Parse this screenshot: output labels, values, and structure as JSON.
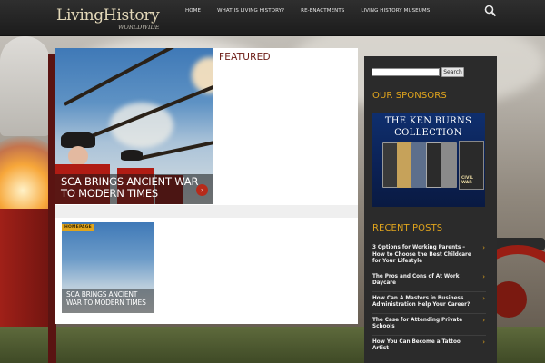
{
  "site": {
    "logo_main": "LivingHistory",
    "logo_sub": "WORLDWIDE"
  },
  "nav": {
    "items": [
      "HOME",
      "WHAT IS LIVING HISTORY?",
      "RE-ENACTMENTS",
      "LIVING HISTORY MUSEUMS"
    ]
  },
  "icons": {
    "search": "search-icon",
    "arrow": "chevron-right-icon"
  },
  "main": {
    "featured_heading": "FEATURED",
    "feature_caption": "SCA BRINGS ANCIENT WAR TO MODERN TIMES",
    "thumb_badge": "HOMEPAGE",
    "thumb_caption": "SCA BRINGS ANCIENT WAR TO MODERN TIMES"
  },
  "sidebar": {
    "search_button": "Search",
    "search_placeholder": "",
    "sponsors_heading": "OUR SPONSORS",
    "sponsor_title_1": "THE KEN BURNS",
    "sponsor_title_2": "COLLECTION",
    "sponsor_dvd_label": "CIVIL WAR",
    "recent_heading": "RECENT POSTS",
    "recent_posts": [
      "3 Options for Working Parents – How to Choose the Best Childcare for Your Lifestyle",
      "The Pros and Cons of At Work Daycare",
      "How Can A Masters in Business Administration Help Your Career?",
      "The Case for Attending Private Schools",
      "How You Can Become a Tattoo Artist"
    ]
  },
  "colors": {
    "accent": "#e1a51d",
    "header": "#1c1c1c",
    "featured_heading": "#6b1a14",
    "sidebar": "#2b2b2b"
  }
}
